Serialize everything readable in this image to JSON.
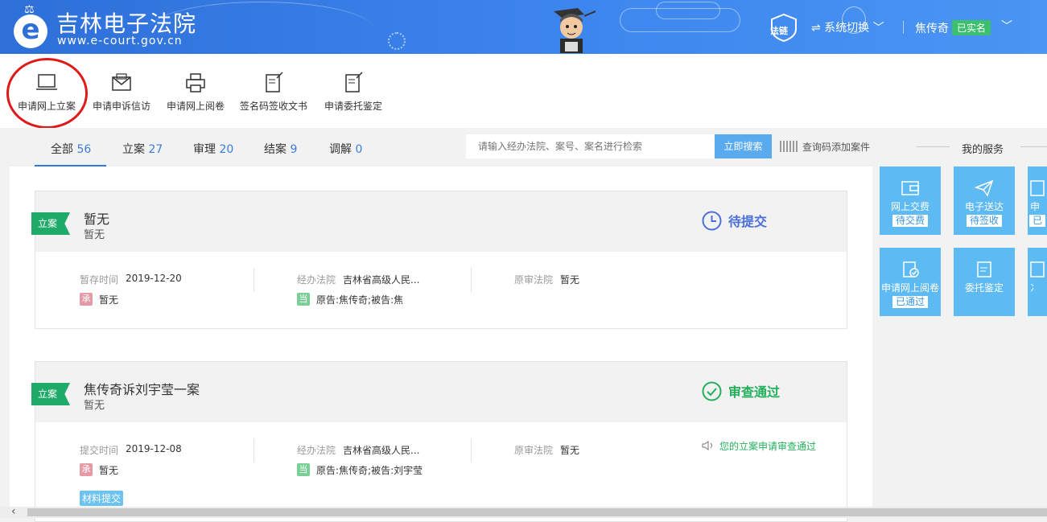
{
  "header": {
    "logo_letter": "e",
    "site_title": "吉林电子法院",
    "site_url": "www.e-court.gov.cn",
    "falian_label": "法链",
    "system_switch": "⇌ 系统切换 ﹀",
    "user_name": "焦传奇",
    "verified_label": "已实名",
    "user_menu_caret": "﹀"
  },
  "toolbar": {
    "items": [
      {
        "label": "申请网上立案",
        "icon": "laptop-icon"
      },
      {
        "label": "申请申诉信访",
        "icon": "envelope-icon"
      },
      {
        "label": "申请网上阅卷",
        "icon": "printer-icon"
      },
      {
        "label": "签名码签收文书",
        "icon": "document-sign-icon"
      },
      {
        "label": "申请委托鉴定",
        "icon": "document-edit-icon"
      }
    ]
  },
  "tabs": [
    {
      "label": "全部",
      "count": "56"
    },
    {
      "label": "立案",
      "count": "27"
    },
    {
      "label": "审理",
      "count": "20"
    },
    {
      "label": "结案",
      "count": "9"
    },
    {
      "label": "调解",
      "count": "0"
    }
  ],
  "search": {
    "placeholder": "请输入经办法院、案号、案名进行检索",
    "button": "立即搜索",
    "code_add": "查询码添加案件"
  },
  "services": {
    "title": "我的服务",
    "tiles": [
      {
        "label": "网上交费",
        "badge": "待交费",
        "icon": "wallet-icon"
      },
      {
        "label": "电子送达",
        "badge": "待签收",
        "icon": "paper-plane-icon"
      },
      {
        "label": "申",
        "badge": "已",
        "icon": "document-icon"
      },
      {
        "label": "申请网上阅卷",
        "badge": "已通过",
        "icon": "document-check-icon"
      },
      {
        "label": "委托鉴定",
        "badge": "",
        "icon": "document-edit-icon"
      },
      {
        "label": "冫",
        "badge": "",
        "icon": "document-icon"
      }
    ]
  },
  "cases": [
    {
      "tag": "立案",
      "title": "暂无",
      "subtitle": "暂无",
      "status": "待提交",
      "status_color": "#4a6fd8",
      "status_icon": "clock-icon",
      "time_label": "暂存时间",
      "time_value": "2019-12-20",
      "court_label": "经办法院",
      "court_value": "吉林省高级人民...",
      "orig_label": "原审法院",
      "orig_value": "暂无",
      "cheng_badge": "承",
      "cheng_value": "暂无",
      "dang_badge": "当",
      "dang_value": "原告:焦传奇;被告:焦"
    },
    {
      "tag": "立案",
      "title": "焦传奇诉刘宇莹一案",
      "subtitle": "暂无",
      "status": "审查通过",
      "status_color": "#22b05b",
      "status_icon": "check-circle-icon",
      "time_label": "提交时间",
      "time_value": "2019-12-08",
      "court_label": "经办法院",
      "court_value": "吉林省高级人民...",
      "orig_label": "原审法院",
      "orig_value": "暂无",
      "cheng_badge": "承",
      "cheng_value": "暂无",
      "dang_badge": "当",
      "dang_value": "原告:焦传奇;被告:刘宇莹",
      "notice": "您的立案申请审查通过",
      "material_tag": "材料提交"
    }
  ],
  "scrollbar": {
    "arrow": "‹"
  }
}
